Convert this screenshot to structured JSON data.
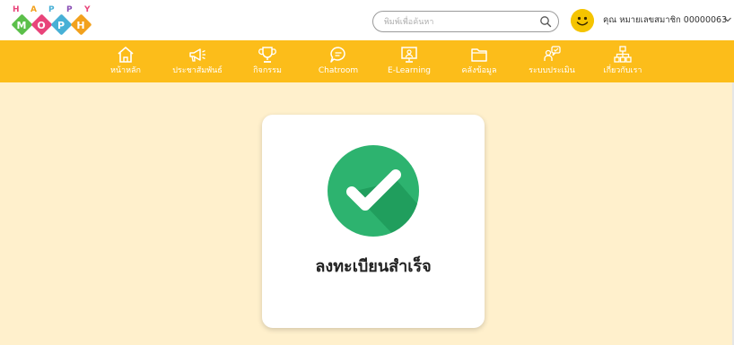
{
  "logo": {
    "letters": [
      "H",
      "A",
      "P",
      "P",
      "Y"
    ],
    "letter_colors": [
      "#e8447a",
      "#f2a11d",
      "#47b0d6",
      "#8a4fb5",
      "#e8447a"
    ],
    "diamonds": [
      {
        "label": "M",
        "color": "#5bbf4a"
      },
      {
        "label": "O",
        "color": "#e8447a"
      },
      {
        "label": "P",
        "color": "#47b0d6"
      },
      {
        "label": "H",
        "color": "#f2a11d"
      }
    ]
  },
  "search": {
    "placeholder": "พิมพ์เพื่อค้นหา"
  },
  "user": {
    "name": "คุณ หมายเลขสมาชิก 00000063"
  },
  "nav": {
    "items": [
      {
        "label": "หน้าหลัก",
        "icon": "home-icon"
      },
      {
        "label": "ประชาสัมพันธ์",
        "icon": "megaphone-icon"
      },
      {
        "label": "กิจกรรม",
        "icon": "trophy-icon"
      },
      {
        "label": "Chatroom",
        "icon": "chat-icon"
      },
      {
        "label": "E-Learning",
        "icon": "elearning-icon"
      },
      {
        "label": "คลังข้อมูล",
        "icon": "folder-icon"
      },
      {
        "label": "ระบบประเมิน",
        "icon": "evaluation-icon"
      },
      {
        "label": "เกี่ยวกับเรา",
        "icon": "sitemap-icon"
      }
    ]
  },
  "main": {
    "message": "ลงทะเบียนสำเร็จ"
  },
  "colors": {
    "nav": "#fcbd1a",
    "background": "#fff0cc",
    "check": "#2db36f"
  }
}
